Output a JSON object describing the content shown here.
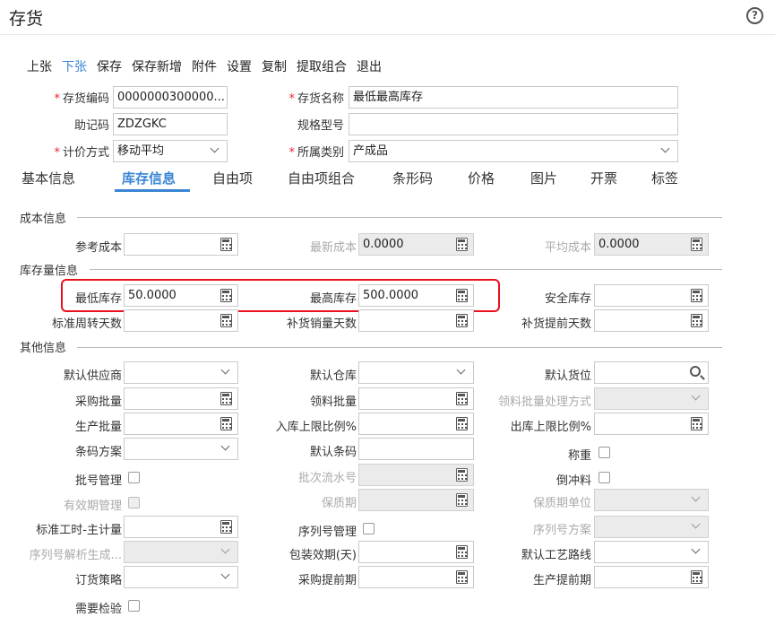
{
  "window": {
    "title": "存货",
    "help_icon": "question-circle-icon"
  },
  "toolbar": [
    "上张",
    "下张",
    "保存",
    "保存新增",
    "附件",
    "设置",
    "复制",
    "提取组合",
    "退出"
  ],
  "header": {
    "code_label": "存货编码",
    "code_value": "0000000300000...",
    "name_label": "存货名称",
    "name_value": "最低最高库存",
    "mnemonic_label": "助记码",
    "mnemonic_value": "ZDZGKC",
    "spec_label": "规格型号",
    "spec_value": "",
    "pricing_label": "计价方式",
    "pricing_value": "移动平均",
    "category_label": "所属类别",
    "category_value": "产成品",
    "required_mark": "*"
  },
  "tabs": [
    "基本信息",
    "库存信息",
    "自由项",
    "自由项组合",
    "条形码",
    "价格",
    "图片",
    "开票",
    "标签"
  ],
  "sections": {
    "cost": "成本信息",
    "stock": "库存量信息",
    "other": "其他信息"
  },
  "cost": {
    "ref_label": "参考成本",
    "ref_value": "",
    "latest_label": "最新成本",
    "latest_value": "0.0000",
    "avg_label": "平均成本",
    "avg_value": "0.0000"
  },
  "stock": {
    "min_label": "最低库存",
    "min_value": "50.0000",
    "max_label": "最高库存",
    "max_value": "500.0000",
    "safe_label": "安全库存",
    "turnover_label": "标准周转天数",
    "replenish_label": "补货销量天数",
    "lead_label": "补货提前天数"
  },
  "other": {
    "supplier_label": "默认供应商",
    "warehouse_label": "默认仓库",
    "location_label": "默认货位",
    "purchase_batch_label": "采购批量",
    "issue_batch_label": "领料批量",
    "issue_batch_mode_label": "领料批量处理方式",
    "prod_batch_label": "生产批量",
    "in_limit_label": "入库上限比例%",
    "out_limit_label": "出库上限比例%",
    "barcode_scheme_label": "条码方案",
    "default_barcode_label": "默认条码",
    "weigh_label": "称重",
    "batch_mgmt_label": "批号管理",
    "batch_serial_label": "批次流水号",
    "backflush_label": "倒冲料",
    "expiry_mgmt_label": "有效期管理",
    "shelf_life_label": "保质期",
    "shelf_unit_label": "保质期单位",
    "std_hours_label": "标准工时-主计量",
    "serial_mgmt_label": "序列号管理",
    "serial_scheme_label": "序列号方案",
    "serial_parse_label": "序列号解析生成...",
    "pack_label": "包装效期(天)",
    "route_label": "默认工艺路线",
    "order_strategy_label": "订货策略",
    "purchase_lead_label": "采购提前期",
    "prod_lead_label": "生产提前期",
    "inspect_label": "需要检验"
  }
}
